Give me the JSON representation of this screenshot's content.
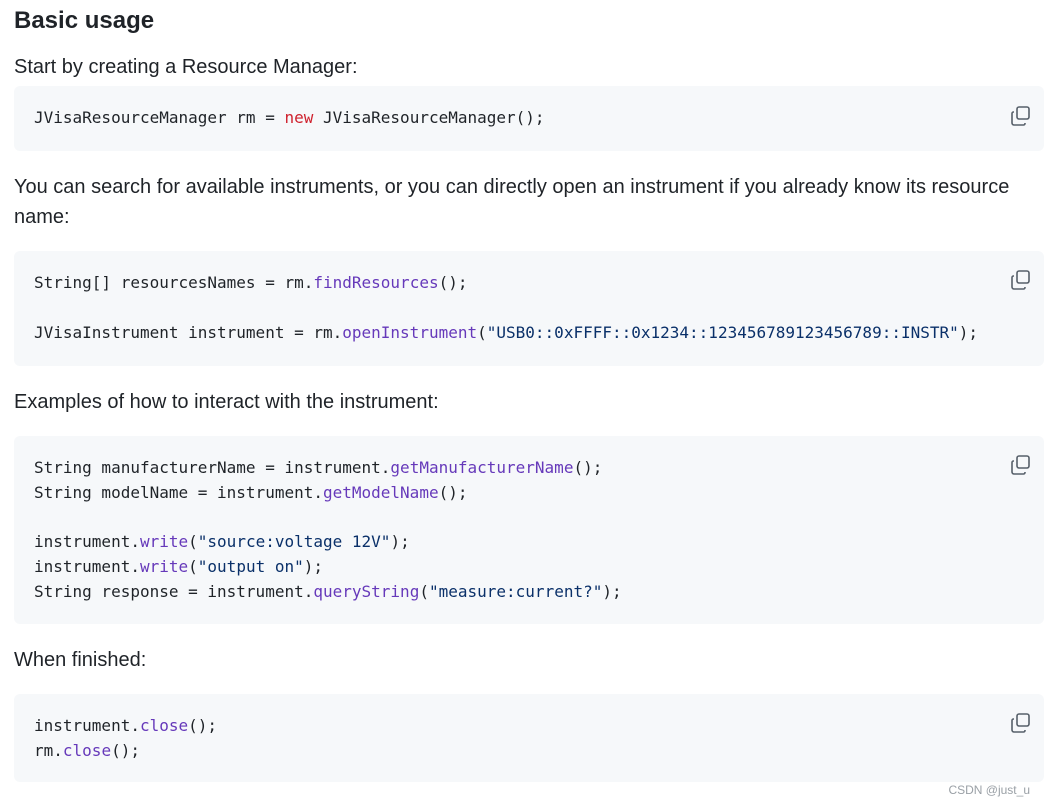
{
  "heading": "Basic usage",
  "intro_text": "Start by creating a Resource Manager:",
  "search_text": "You can search for available instruments, or you can directly open an instrument if you already know its resource name:",
  "examples_text": "Examples of how to interact with the instrument:",
  "finished_text": "When finished:",
  "code1": {
    "line1": {
      "a": "JVisaResourceManager rm = ",
      "kw": "new",
      "b": " JVisaResourceManager();"
    }
  },
  "code2": {
    "line1": {
      "a": "String[] resourcesNames = rm.",
      "fn": "findResources",
      "b": "();"
    },
    "line2": {
      "a": "JVisaInstrument instrument = rm.",
      "fn": "openInstrument",
      "b": "(",
      "str": "\"USB0::0xFFFF::0x1234::123456789123456789::INSTR\"",
      "c": ");"
    }
  },
  "code3": {
    "line1": {
      "a": "String manufacturerName = instrument.",
      "fn": "getManufacturerName",
      "b": "();"
    },
    "line2": {
      "a": "String modelName = instrument.",
      "fn": "getModelName",
      "b": "();"
    },
    "line3": {
      "a": "instrument.",
      "fn": "write",
      "b": "(",
      "str": "\"source:voltage 12V\"",
      "c": ");"
    },
    "line4": {
      "a": "instrument.",
      "fn": "write",
      "b": "(",
      "str": "\"output on\"",
      "c": ");"
    },
    "line5": {
      "a": "String response = instrument.",
      "fn": "queryString",
      "b": "(",
      "str": "\"measure:current?\"",
      "c": ");"
    }
  },
  "code4": {
    "line1": {
      "a": "instrument.",
      "fn": "close",
      "b": "();"
    },
    "line2": {
      "a": "rm.",
      "fn": "close",
      "b": "();"
    }
  },
  "copy_icon": "copy-icon",
  "watermark": "CSDN @just_u",
  "colors": {
    "code_background": "#f6f8fa",
    "keyword": "#cf222e",
    "function": "#6639ba",
    "string": "#0a3069",
    "text": "#1f2328"
  }
}
